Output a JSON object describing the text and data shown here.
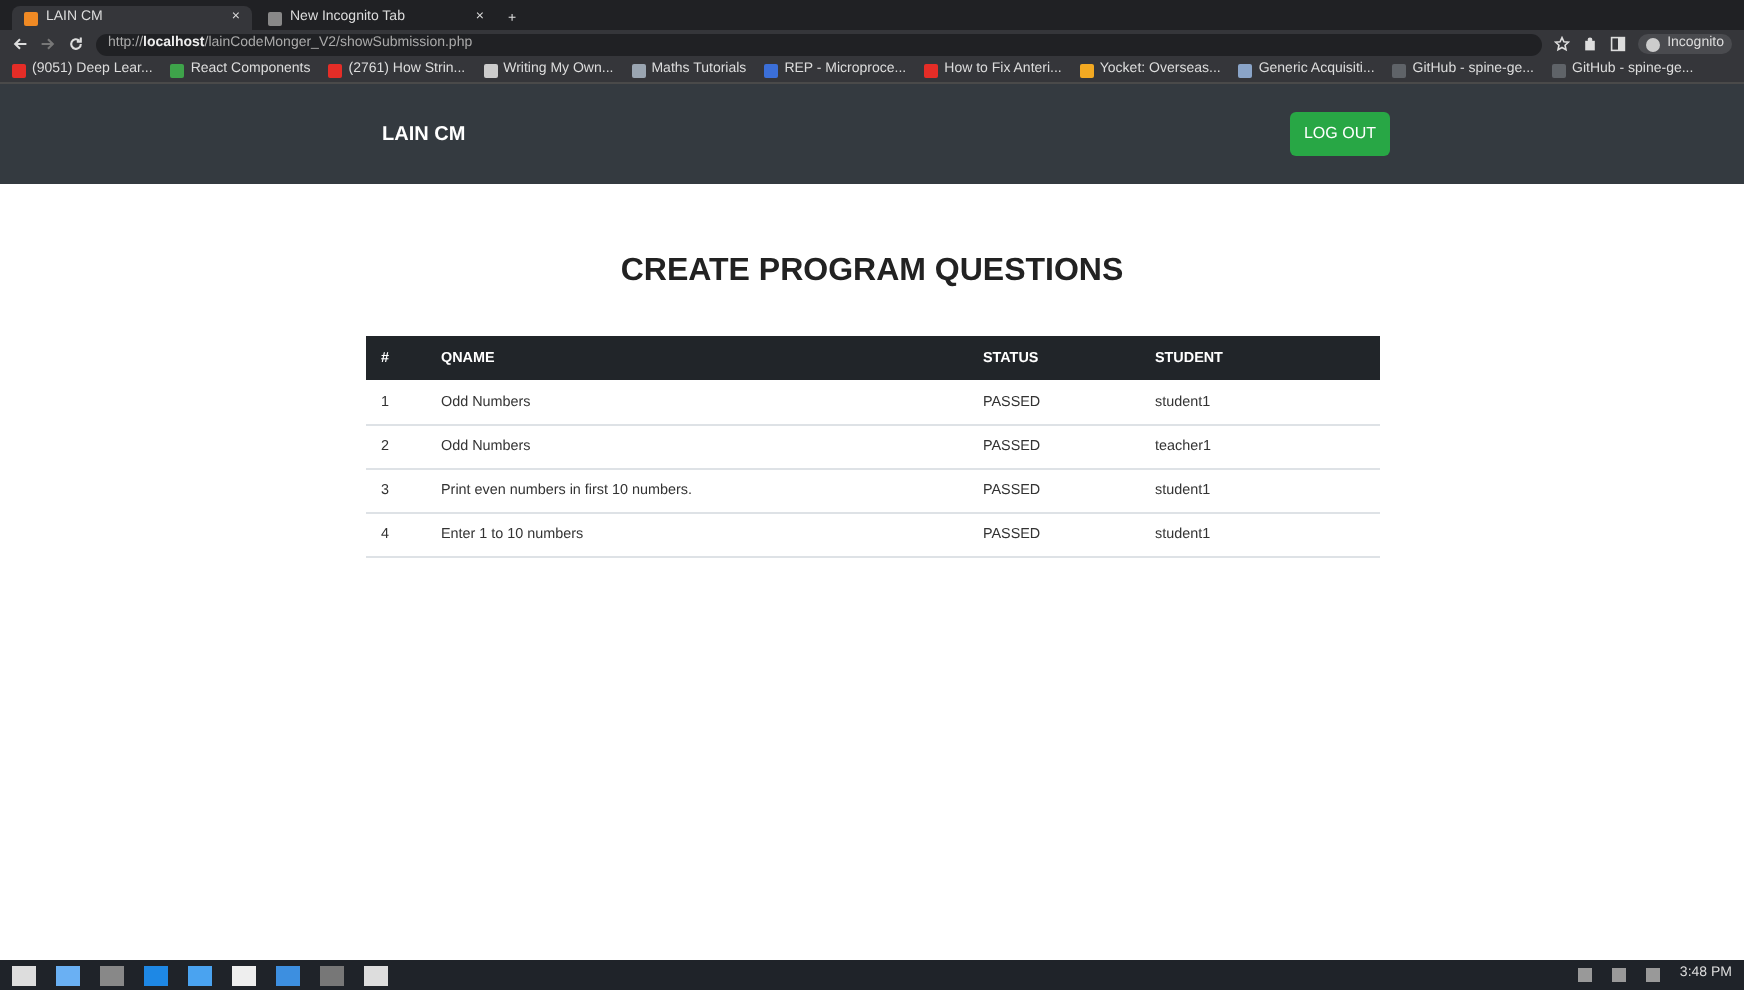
{
  "browser": {
    "tabs": [
      {
        "title": "LAIN CM",
        "selected": true
      },
      {
        "title": "New Incognito Tab",
        "selected": false
      }
    ],
    "close_glyph": "×",
    "new_tab_glyph": "+",
    "address": {
      "scheme": "http://",
      "host": "localhost",
      "path": "/lainCodeMonger_V2/showSubmission.php"
    },
    "profile": "Incognito",
    "bookmarks": [
      {
        "label": "(9051) Deep Lear...",
        "color": "#e52d27"
      },
      {
        "label": "React Components",
        "color": "#3ea34a"
      },
      {
        "label": "(2761) How Strin...",
        "color": "#e52d27"
      },
      {
        "label": "Writing My Own...",
        "color": "#cccccc"
      },
      {
        "label": "Maths Tutorials",
        "color": "#9aa5b1"
      },
      {
        "label": "REP - Microproce...",
        "color": "#3b6fd8"
      },
      {
        "label": "How to Fix Anteri...",
        "color": "#e52d27"
      },
      {
        "label": "Yocket: Overseas...",
        "color": "#f2a922"
      },
      {
        "label": "Generic Acquisiti...",
        "color": "#8aa4c8"
      },
      {
        "label": "GitHub - spine-ge...",
        "color": "#5f6368"
      },
      {
        "label": "GitHub - spine-ge...",
        "color": "#5f6368"
      }
    ]
  },
  "navbar": {
    "brand": "LAIN CM",
    "button": "LOG OUT"
  },
  "heading": "CREATE PROGRAM QUESTIONS",
  "table": {
    "columns": [
      "#",
      "QNAME",
      "STATUS",
      "STUDENT"
    ],
    "rows": [
      [
        "1",
        "Odd Numbers",
        "PASSED",
        "student1"
      ],
      [
        "2",
        "Odd Numbers",
        "PASSED",
        "teacher1"
      ],
      [
        "3",
        "Print even numbers in first 10 numbers.",
        "PASSED",
        "student1"
      ],
      [
        "4",
        "Enter 1 to 10 numbers",
        "PASSED",
        "student1"
      ]
    ]
  },
  "taskbar": {
    "time": "3:48 PM"
  }
}
